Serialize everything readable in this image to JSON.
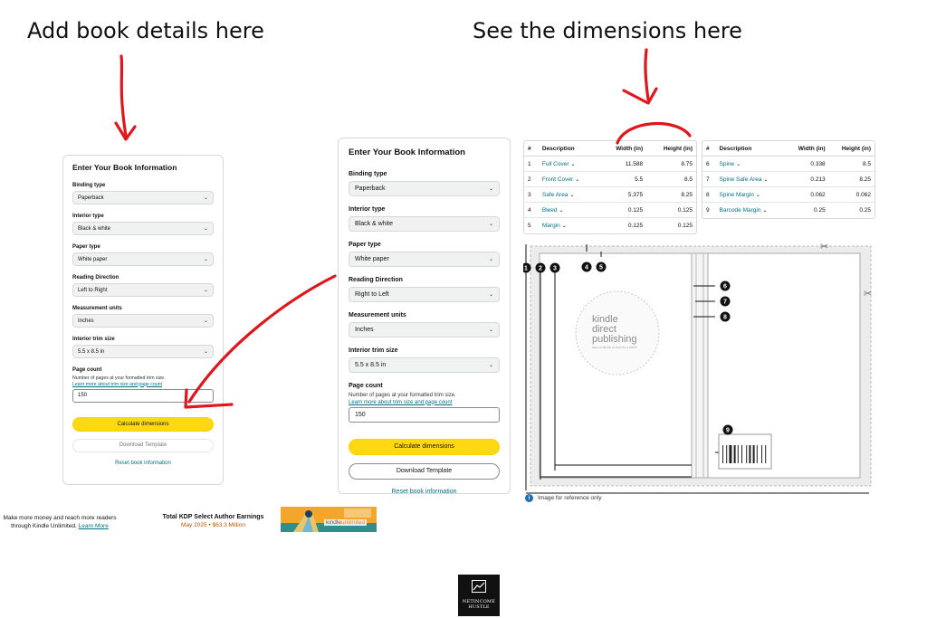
{
  "captions": {
    "left": "Add book details here",
    "right": "See the dimensions here"
  },
  "colors": {
    "annotation_red": "#e0161c",
    "button_yellow": "#ffd814",
    "link_teal": "#007185",
    "info_blue": "#1f6fb5"
  },
  "form_left": {
    "heading": "Enter Your Book Information",
    "binding_type": {
      "label": "Binding type",
      "value": "Paperback"
    },
    "interior_type": {
      "label": "Interior type",
      "value": "Black & white"
    },
    "paper_type": {
      "label": "Paper type",
      "value": "White paper"
    },
    "reading_direction": {
      "label": "Reading Direction",
      "value": "Left to Right"
    },
    "measurement_units": {
      "label": "Measurement units",
      "value": "Inches"
    },
    "trim_size": {
      "label": "Interior trim size",
      "value": "5.5 x 8.5 in"
    },
    "page_count": {
      "label": "Page count",
      "help": "Number of pages at your formatted trim size.",
      "link": "Learn more about trim size and page count",
      "value": "150"
    },
    "calculate_label": "Calculate dimensions",
    "download_label": "Download Template",
    "reset_label": "Reset book information"
  },
  "form_right": {
    "heading": "Enter Your Book Information",
    "binding_type": {
      "label": "Binding type",
      "value": "Paperback"
    },
    "interior_type": {
      "label": "Interior type",
      "value": "Black & white"
    },
    "paper_type": {
      "label": "Paper type",
      "value": "White paper"
    },
    "reading_direction": {
      "label": "Reading Direction",
      "value": "Right to Left"
    },
    "measurement_units": {
      "label": "Measurement units",
      "value": "Inches"
    },
    "trim_size": {
      "label": "Interior trim size",
      "value": "5.5 x 8.5 in"
    },
    "page_count": {
      "label": "Page count",
      "help": "Number of pages at your formatted trim size.",
      "link": "Learn more about trim size and page count",
      "value": "150"
    },
    "calculate_label": "Calculate dimensions",
    "download_label": "Download Template",
    "reset_label": "Reset book information"
  },
  "banner": {
    "left_line1": "Make more money and reach more readers",
    "left_line2": "through Kindle Unlimited.",
    "left_link": "Learn More",
    "title": "Total KDP Select Author Earnings",
    "stat": "May 2025 • $63.3 Million",
    "logo_kindle": "kindle",
    "logo_unlimited": "unlimited"
  },
  "table_headers": {
    "num": "#",
    "description": "Description",
    "width": "Width (in)",
    "height": "Height (in)"
  },
  "table_1": [
    {
      "n": "1",
      "desc": "Full Cover",
      "w": "11.588",
      "h": "8.75"
    },
    {
      "n": "2",
      "desc": "Front Cover",
      "w": "5.5",
      "h": "8.5"
    },
    {
      "n": "3",
      "desc": "Safe Area",
      "w": "5.375",
      "h": "8.25"
    },
    {
      "n": "4",
      "desc": "Bleed",
      "w": "0.125",
      "h": "0.125"
    },
    {
      "n": "5",
      "desc": "Margin",
      "w": "0.125",
      "h": "0.125"
    }
  ],
  "table_2": [
    {
      "n": "6",
      "desc": "Spine",
      "w": "0.338",
      "h": "8.5"
    },
    {
      "n": "7",
      "desc": "Spine Safe Area",
      "w": "0.213",
      "h": "8.25"
    },
    {
      "n": "8",
      "desc": "Spine Margin",
      "w": "0.062",
      "h": "0.062"
    },
    {
      "n": "9",
      "desc": "Barcode Margin",
      "w": "0.25",
      "h": "0.25"
    }
  ],
  "template": {
    "kdp_logo_line1": "kindle",
    "kdp_logo_line2": "direct",
    "kdp_logo_line3": "publishing",
    "kdp_logo_tagline": "SELF-PUBLISH IN DIGITAL & PRINT",
    "markers": [
      "1",
      "2",
      "3",
      "4",
      "5",
      "6",
      "7",
      "8",
      "9"
    ],
    "reference_note": "Image for reference only"
  },
  "brand": {
    "line1": "NETINCOME",
    "line2": "HUSTLE"
  }
}
